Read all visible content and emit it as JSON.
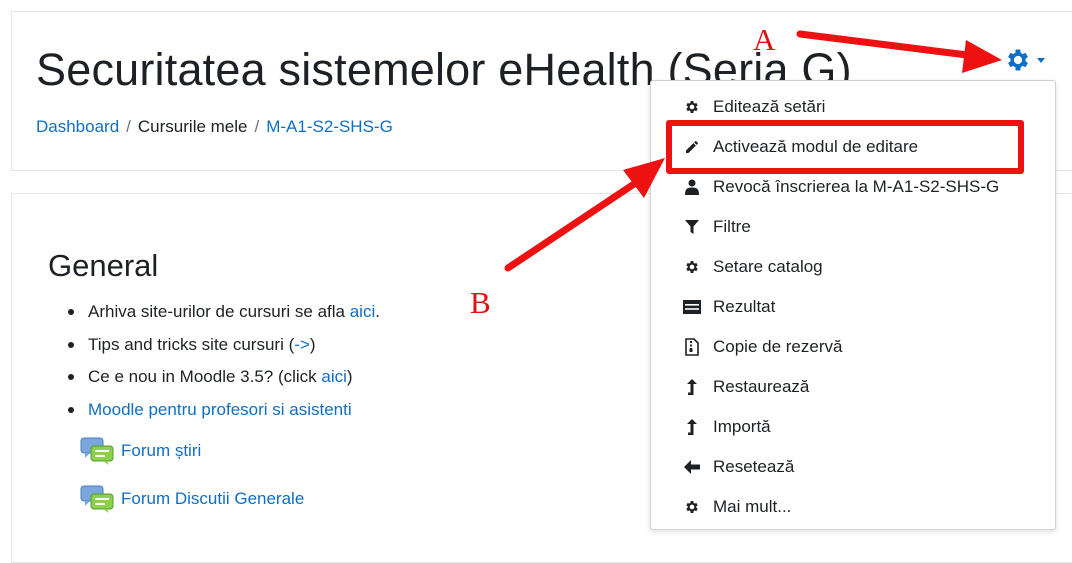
{
  "header": {
    "title": "Securitatea sistemelor eHealth (Seria G)",
    "breadcrumb": [
      {
        "label": "Dashboard"
      },
      {
        "label": "Cursurile mele"
      },
      {
        "label": "M-A1-S2-SHS-G"
      }
    ],
    "separator": "/"
  },
  "section": {
    "title": "General",
    "items": [
      {
        "text": "Arhiva site-urilor de cursuri se afla ",
        "link": "aici",
        "after": "."
      },
      {
        "text": "Tips and tricks site cursuri (",
        "link": "->",
        "after": ")"
      },
      {
        "text": "Ce e nou in Moodle 3.5? (click ",
        "link": "aici",
        "after": ")"
      },
      {
        "text": "",
        "link": "Moodle pentru profesori si asistenti",
        "after": ""
      }
    ],
    "forums": [
      {
        "label": "Forum știri"
      },
      {
        "label": "Forum Discutii Generale"
      }
    ]
  },
  "course_menu": {
    "trigger_icon": "gear-icon",
    "items": [
      {
        "label": "Editează setări",
        "icon": "gear-icon"
      },
      {
        "label": "Activează modul de editare",
        "icon": "pencil-icon"
      },
      {
        "label": "Revocă înscrierea la M-A1-S2-SHS-G",
        "icon": "user-icon"
      },
      {
        "label": "Filtre",
        "icon": "filter-icon"
      },
      {
        "label": "Setare catalog",
        "icon": "gear-icon"
      },
      {
        "label": "Rezultat",
        "icon": "table-icon"
      },
      {
        "label": "Copie de rezervă",
        "icon": "file-archive-icon"
      },
      {
        "label": "Restaurează",
        "icon": "level-up-icon"
      },
      {
        "label": "Importă",
        "icon": "level-up-icon"
      },
      {
        "label": "Resetează",
        "icon": "arrow-left-icon"
      },
      {
        "label": "Mai mult...",
        "icon": "gear-icon"
      }
    ]
  },
  "annotations": {
    "letter_a": "A",
    "letter_b": "B",
    "color": "#e01010"
  },
  "colors": {
    "link": "#0f6fc5",
    "text": "#1d2125",
    "annotation": "#e01010"
  }
}
